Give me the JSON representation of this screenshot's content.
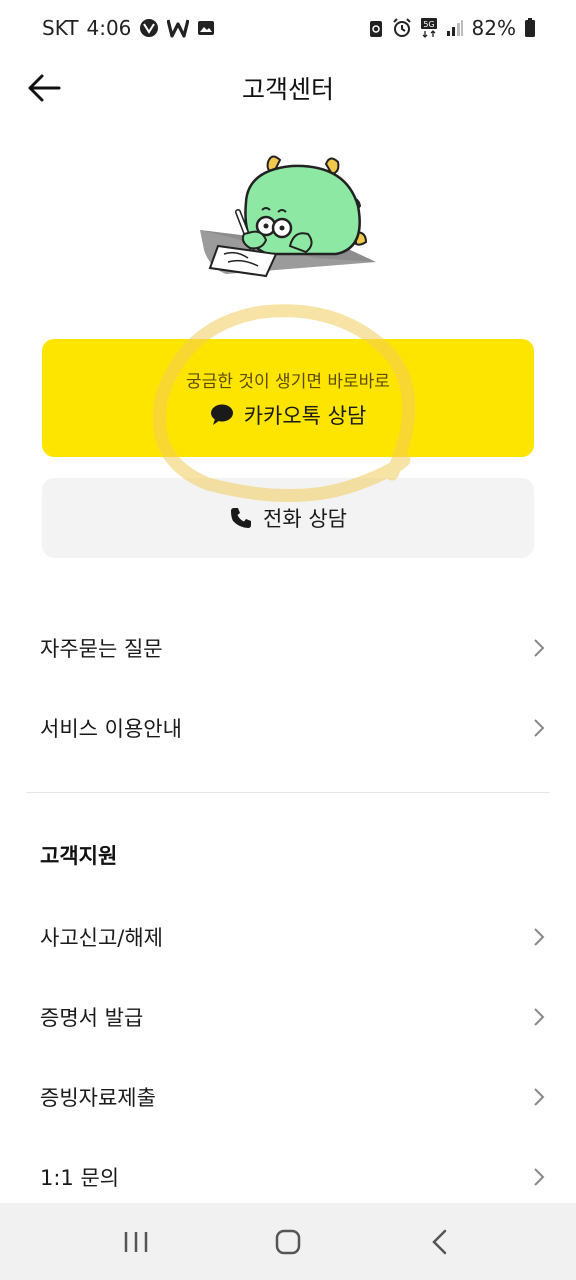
{
  "status_bar": {
    "carrier": "SKT",
    "time": "4:06",
    "network": "5G",
    "battery": "82%",
    "left_icons": [
      "vpn-icon",
      "w-app-icon",
      "gallery-icon"
    ],
    "right_icons": [
      "recycle-icon",
      "alarm-icon",
      "5g-icon",
      "signal-icon",
      "battery-icon"
    ]
  },
  "header": {
    "title": "고객센터",
    "back_icon": "arrow-left-icon"
  },
  "mascot": {
    "icon": "dinosaur-mascot-writing"
  },
  "kakao_consult": {
    "subtitle": "궁금한 것이 생기면 바로바로",
    "label": "카카오톡 상담",
    "icon": "speech-bubble-icon",
    "color": "#fee500"
  },
  "phone_consult": {
    "label": "전화 상담",
    "icon": "phone-icon"
  },
  "help_menu": [
    {
      "label": "자주묻는 질문"
    },
    {
      "label": "서비스 이용안내"
    }
  ],
  "support_section": {
    "title": "고객지원",
    "items": [
      {
        "label": "사고신고/해제"
      },
      {
        "label": "증명서 발급"
      },
      {
        "label": "증빙자료제출"
      },
      {
        "label": "1:1 문의"
      }
    ]
  },
  "nav_bar": {
    "buttons": [
      "recent-apps-icon",
      "home-icon",
      "back-icon"
    ]
  }
}
